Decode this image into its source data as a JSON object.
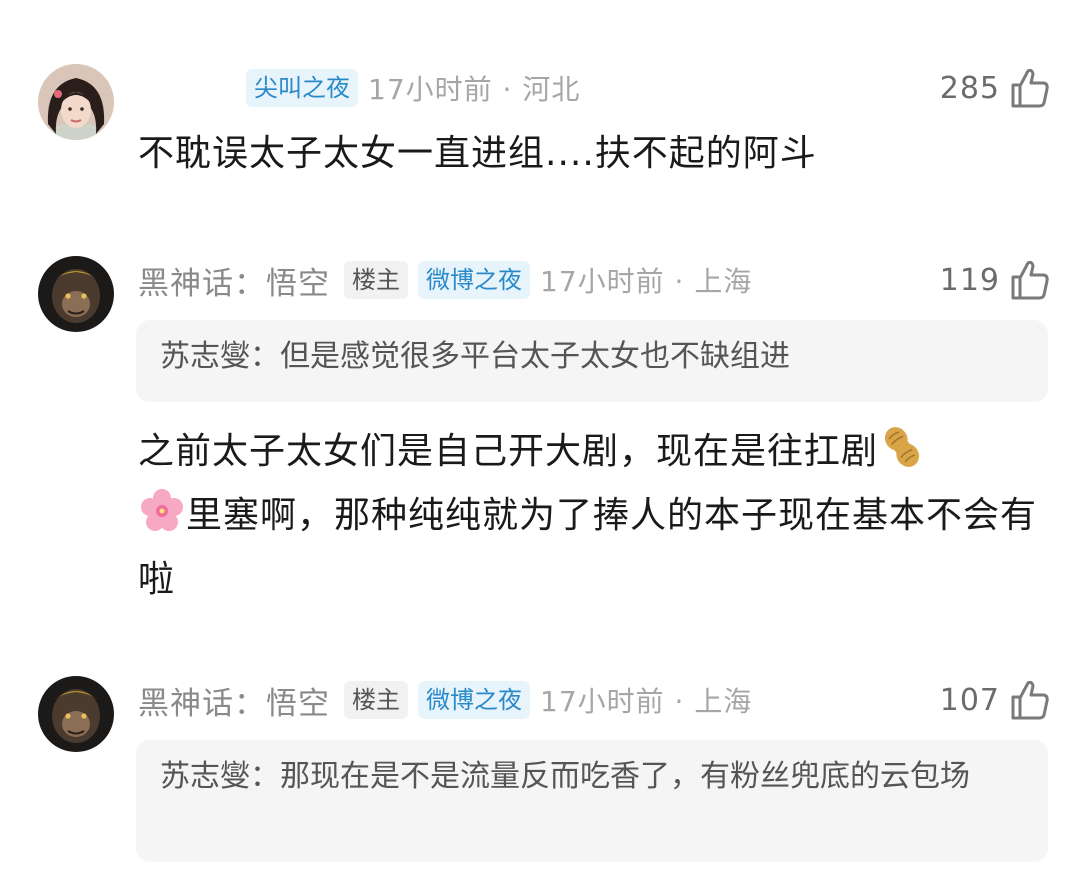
{
  "comments": [
    {
      "username": "",
      "event_badge": "尖叫之夜",
      "time": "17小时前",
      "location": "河北",
      "likes": "285",
      "text": "不耽误太子太女一直进组....扶不起的阿斗"
    },
    {
      "username": "黑神话：悟空",
      "owner_badge": "楼主",
      "event_badge": "微博之夜",
      "time": "17小时前",
      "location": "上海",
      "likes": "119",
      "quote_name": "苏志燮：",
      "quote_text": "但是感觉很多平台太子太女也不缺组进",
      "text_1": "之前太子太女们是自己开大剧，现在是往扛剧",
      "emoji_1": "peanut-emoji",
      "text_2": "里塞啊，那种纯纯就为了捧人的本子现在基本不会有啦",
      "emoji_2": "cherry-blossom-emoji"
    },
    {
      "username": "黑神话：悟空",
      "owner_badge": "楼主",
      "event_badge": "微博之夜",
      "time": "17小时前",
      "location": "上海",
      "likes": "107",
      "quote_name": "苏志燮：",
      "quote_text": "那现在是不是流量反而吃香了，有粉丝兜底的云包场"
    }
  ],
  "colors": {
    "event_badge_bg": "#e8f4fb",
    "event_badge_text": "#2a8ac9",
    "meta_gray": "#a6a6a6",
    "quote_bg": "#f5f5f5"
  },
  "icons": {
    "like": "thumbs-up-icon"
  }
}
